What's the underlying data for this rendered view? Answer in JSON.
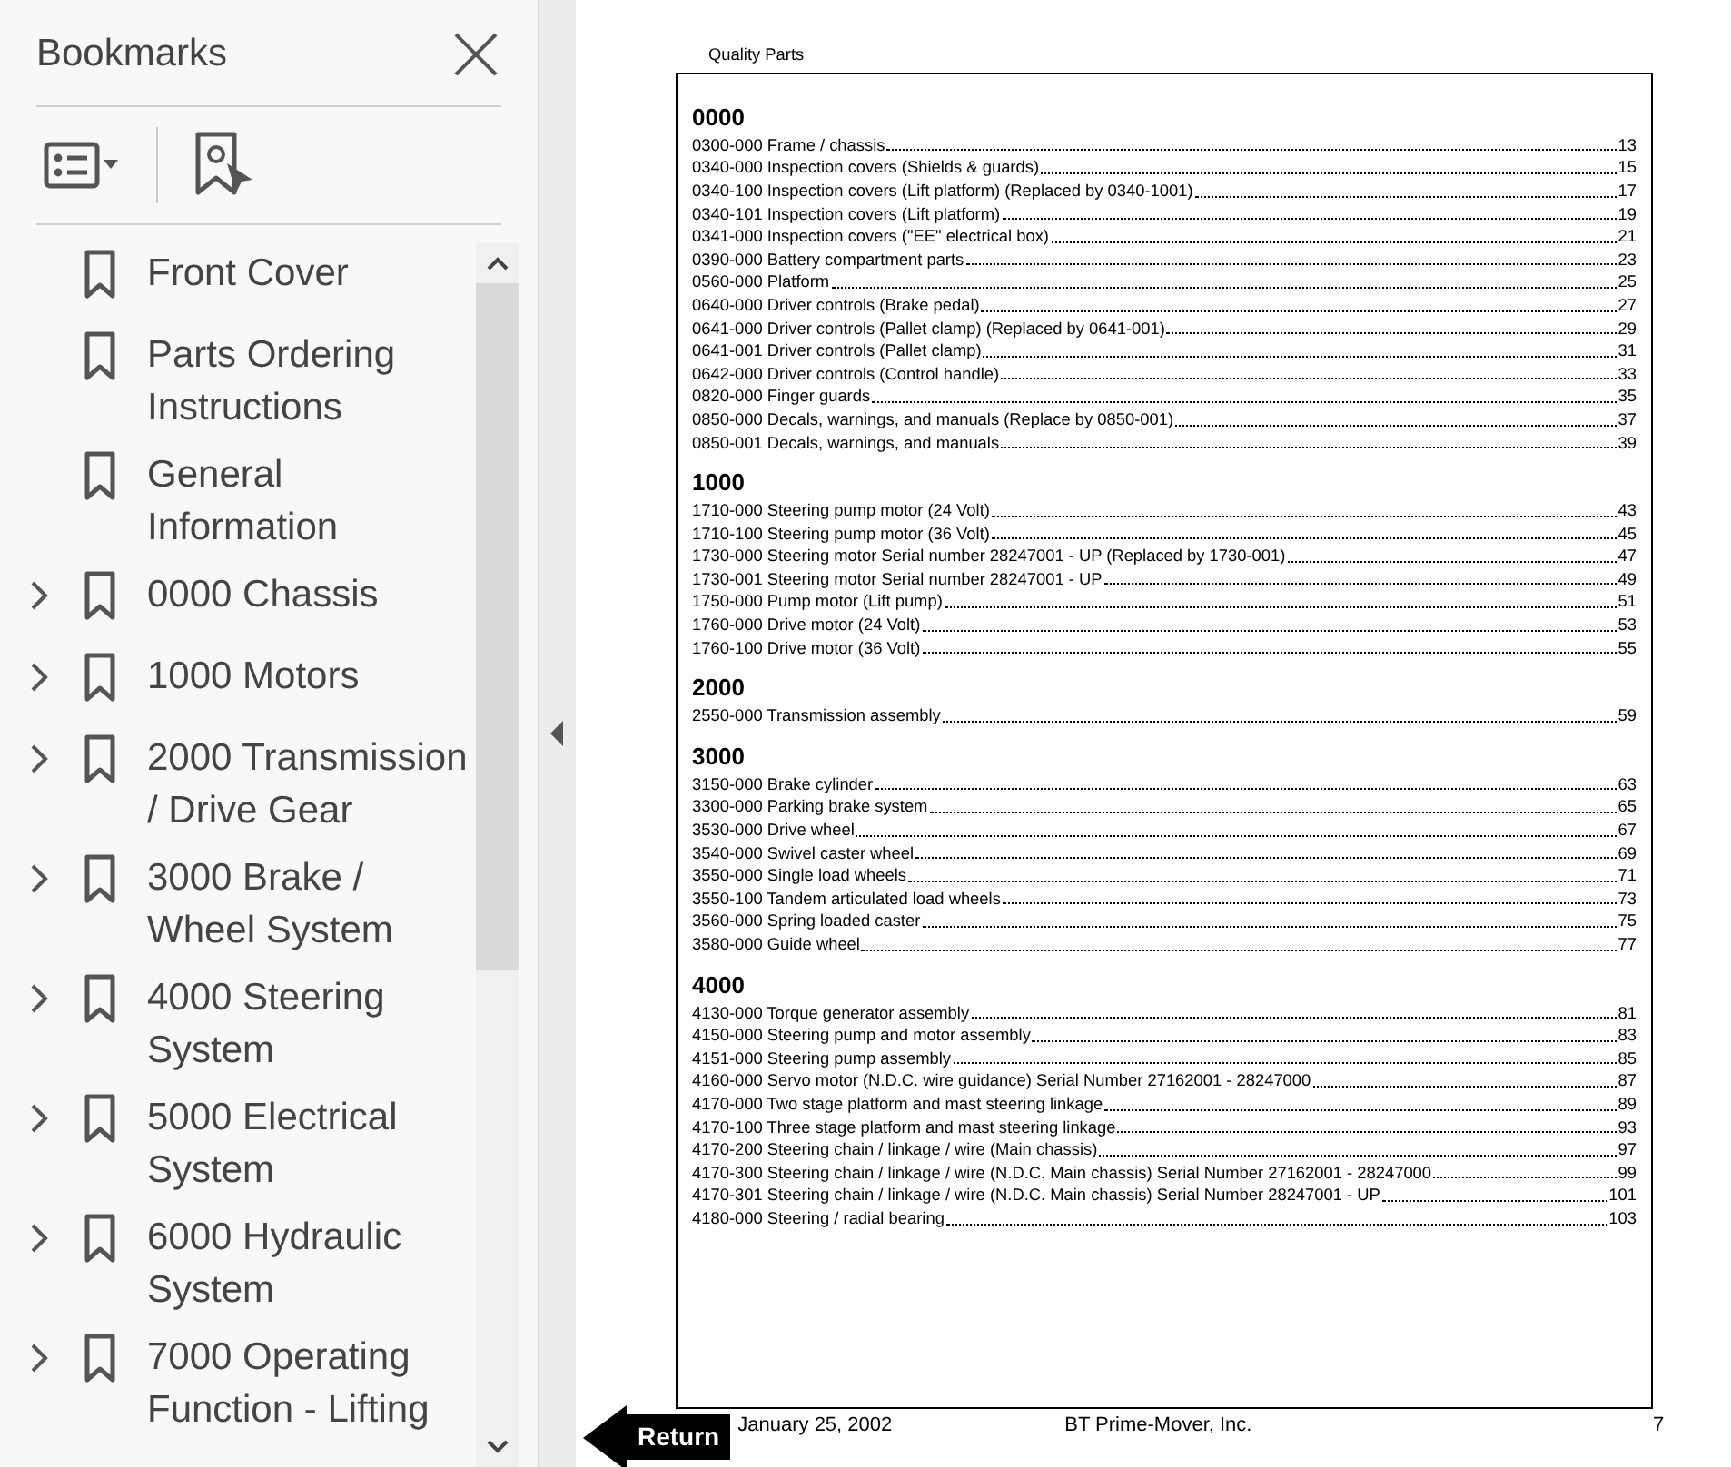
{
  "sidebar": {
    "title": "Bookmarks",
    "items": [
      {
        "label": "Front Cover",
        "expandable": false
      },
      {
        "label": "Parts Ordering Instructions",
        "expandable": false
      },
      {
        "label": "General Information",
        "expandable": false
      },
      {
        "label": "0000 Chassis",
        "expandable": true
      },
      {
        "label": "1000 Motors",
        "expandable": true
      },
      {
        "label": "2000 Transmission / Drive Gear",
        "expandable": true
      },
      {
        "label": "3000 Brake / Wheel System",
        "expandable": true
      },
      {
        "label": "4000 Steering System",
        "expandable": true
      },
      {
        "label": "5000 Electrical System",
        "expandable": true
      },
      {
        "label": "6000 Hydraulic System",
        "expandable": true
      },
      {
        "label": "7000 Operating Function - Lifting",
        "expandable": true
      }
    ]
  },
  "page": {
    "header": "Quality Parts",
    "sections": [
      {
        "heading": "0000",
        "entries": [
          {
            "text": "0300-000 Frame / chassis",
            "page": "13"
          },
          {
            "text": "0340-000 Inspection covers (Shields & guards)",
            "page": "15"
          },
          {
            "text": "0340-100 Inspection covers (Lift platform) (Replaced by 0340-1001)",
            "page": "17"
          },
          {
            "text": "0340-101 Inspection covers (Lift platform)",
            "page": "19"
          },
          {
            "text": "0341-000 Inspection covers (\"EE\" electrical box)",
            "page": "21"
          },
          {
            "text": "0390-000 Battery compartment parts",
            "page": "23"
          },
          {
            "text": "0560-000 Platform",
            "page": "25"
          },
          {
            "text": "0640-000 Driver controls (Brake pedal)",
            "page": "27"
          },
          {
            "text": "0641-000 Driver controls (Pallet clamp) (Replaced by 0641-001)",
            "page": "29"
          },
          {
            "text": "0641-001 Driver controls (Pallet clamp)",
            "page": "31"
          },
          {
            "text": "0642-000 Driver controls (Control handle)",
            "page": "33"
          },
          {
            "text": "0820-000 Finger guards",
            "page": "35"
          },
          {
            "text": "0850-000 Decals, warnings, and manuals (Replace by 0850-001)",
            "page": "37"
          },
          {
            "text": "0850-001 Decals, warnings, and manuals",
            "page": "39"
          }
        ]
      },
      {
        "heading": "1000",
        "entries": [
          {
            "text": "1710-000 Steering pump motor (24 Volt)",
            "page": "43"
          },
          {
            "text": "1710-100 Steering pump motor (36 Volt)",
            "page": "45"
          },
          {
            "text": "1730-000 Steering motor Serial number 28247001 - UP (Replaced by 1730-001)",
            "page": "47"
          },
          {
            "text": "1730-001 Steering motor Serial number 28247001 - UP",
            "page": "49"
          },
          {
            "text": "1750-000 Pump motor (Lift pump)",
            "page": "51"
          },
          {
            "text": "1760-000 Drive motor (24 Volt)",
            "page": "53"
          },
          {
            "text": "1760-100 Drive motor (36 Volt)",
            "page": "55"
          }
        ]
      },
      {
        "heading": "2000",
        "entries": [
          {
            "text": "2550-000 Transmission assembly",
            "page": "59"
          }
        ]
      },
      {
        "heading": "3000",
        "entries": [
          {
            "text": "3150-000 Brake cylinder",
            "page": "63"
          },
          {
            "text": "3300-000 Parking brake system",
            "page": "65"
          },
          {
            "text": "3530-000 Drive wheel",
            "page": "67"
          },
          {
            "text": "3540-000 Swivel caster wheel",
            "page": "69"
          },
          {
            "text": "3550-000 Single load wheels",
            "page": "71"
          },
          {
            "text": "3550-100 Tandem articulated load wheels",
            "page": "73"
          },
          {
            "text": "3560-000 Spring loaded caster",
            "page": "75"
          },
          {
            "text": "3580-000 Guide wheel",
            "page": "77"
          }
        ]
      },
      {
        "heading": "4000",
        "entries": [
          {
            "text": "4130-000 Torque generator assembly",
            "page": "81"
          },
          {
            "text": "4150-000 Steering pump and motor assembly",
            "page": "83"
          },
          {
            "text": "4151-000 Steering pump assembly",
            "page": "85"
          },
          {
            "text": "4160-000 Servo motor (N.D.C. wire guidance) Serial Number 27162001 - 28247000",
            "page": "87"
          },
          {
            "text": "4170-000 Two stage platform and mast steering linkage",
            "page": "89"
          },
          {
            "text": "4170-100 Three stage platform and mast steering linkage",
            "page": "93"
          },
          {
            "text": "4170-200 Steering chain / linkage / wire (Main chassis)",
            "page": "97"
          },
          {
            "text": "4170-300 Steering chain / linkage / wire (N.D.C. Main chassis) Serial Number 27162001 - 28247000",
            "page": "99"
          },
          {
            "text": "4170-301 Steering chain / linkage / wire (N.D.C. Main chassis) Serial Number 28247001 - UP",
            "page": "101"
          },
          {
            "text": "4180-000 Steering / radial bearing",
            "page": "103"
          }
        ]
      }
    ],
    "footer": {
      "date": "January 25, 2002",
      "company": "BT Prime-Mover, Inc.",
      "page_number": "7"
    },
    "return_button": "Return"
  }
}
